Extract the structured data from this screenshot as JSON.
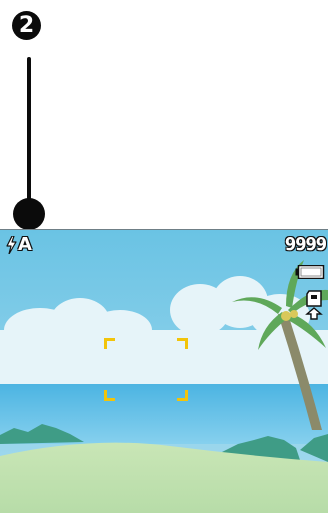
{
  "callout": {
    "number": "2"
  },
  "osd": {
    "flash_mode_label": "A",
    "flash_icon": "flash-bolt-icon",
    "shots_remaining": "9999",
    "battery_icon": "battery-full-icon",
    "storage_icon": "sd-card-icon"
  },
  "colors": {
    "sky": "#6fc6e6",
    "sea": "#4db7e4",
    "sand": "#cfe8b8",
    "focus_frame": "#f2c40a",
    "callout": "#0b0b0b"
  }
}
